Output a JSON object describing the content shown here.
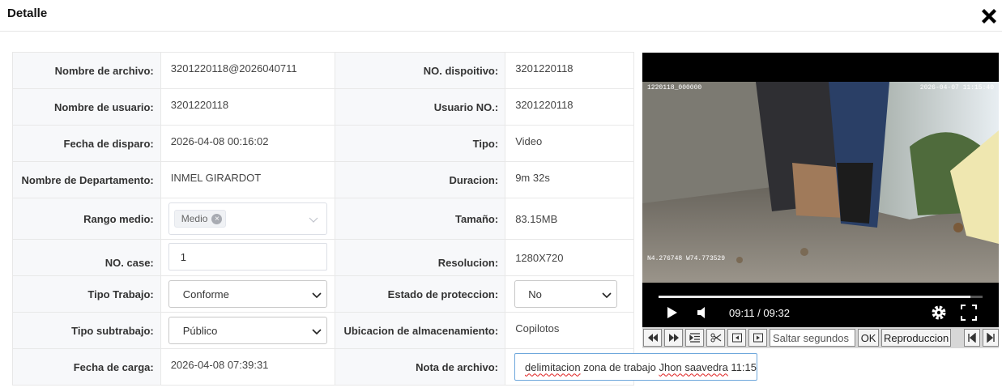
{
  "header": {
    "title": "Detalle"
  },
  "fields": {
    "nombre_archivo": {
      "label": "Nombre de archivo:",
      "value": "3201220118@2026040711"
    },
    "no_dispositivo": {
      "label": "NO. dispoitivo:",
      "value": "3201220118"
    },
    "nombre_usuario": {
      "label": "Nombre de usuario:",
      "value": "3201220118"
    },
    "usuario_no": {
      "label": "Usuario NO.:",
      "value": "3201220118"
    },
    "fecha_disparo": {
      "label": "Fecha de disparo:",
      "value": "2026-04-08 00:16:02"
    },
    "tipo": {
      "label": "Tipo:",
      "value": "Video"
    },
    "departamento": {
      "label": "Nombre de Departamento:",
      "value": "INMEL GIRARDOT"
    },
    "duracion": {
      "label": "Duracion:",
      "value": "9m 32s"
    },
    "rango_medio": {
      "label": "Rango medio:",
      "tag": "Medio"
    },
    "tamano": {
      "label": "Tamaño:",
      "value": "83.15MB"
    },
    "no_case": {
      "label": "NO. case:",
      "value": "1"
    },
    "resolucion": {
      "label": "Resolucion:",
      "value": "1280X720"
    },
    "tipo_trabajo": {
      "label": "Tipo Trabajo:",
      "value": "Conforme"
    },
    "estado_proteccion": {
      "label": "Estado de proteccion:",
      "value": "No"
    },
    "tipo_subtrabajo": {
      "label": "Tipo subtrabajo:",
      "value": "Público"
    },
    "ubicacion": {
      "label": "Ubicacion de almacenamiento:",
      "value": "Copilotos"
    },
    "fecha_carga": {
      "label": "Fecha de carga:",
      "value": "2026-04-08 07:39:31"
    },
    "nota_archivo": {
      "label": "Nota de archivo:",
      "value_pre": "",
      "value_squiggle1": "delimitacion",
      "value_mid": " zona de trabajo ",
      "value_squiggle2": "Jhon saavedra",
      "value_post": " 11:15"
    }
  },
  "player": {
    "osd_left": "1220118_000000",
    "osd_right": "2026-04-07 11:15:40",
    "osd_coords": "N4.276748  W74.773529",
    "time": "09:11 / 09:32",
    "progress_fraction": 0.963
  },
  "toolbar": {
    "seek_placeholder": "Saltar segundos",
    "ok_label": "OK",
    "playback_label": "Reproduccion"
  },
  "colors": {
    "note_border": "#6fa8dc",
    "label_bg": "#f7f8fa"
  }
}
